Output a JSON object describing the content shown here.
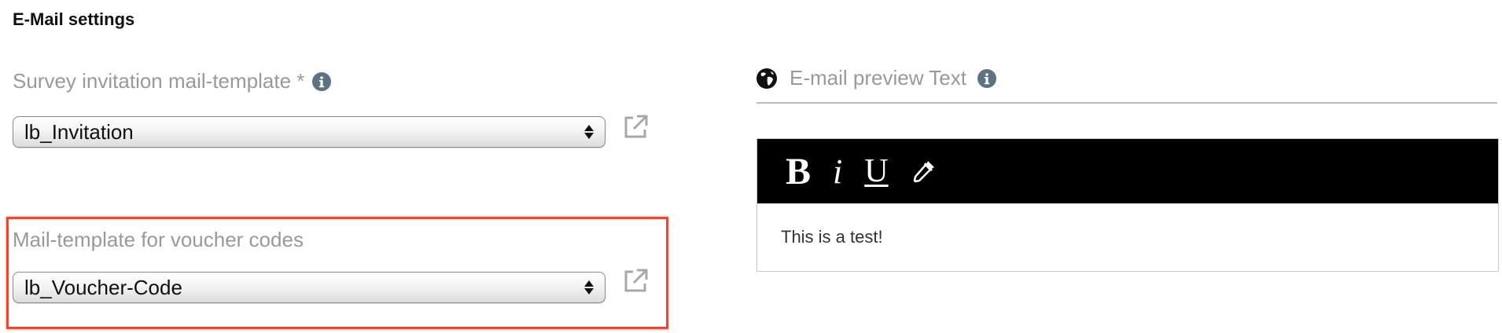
{
  "section": {
    "title": "E-Mail settings"
  },
  "invitation": {
    "label": "Survey invitation mail-template *",
    "selected": "lb_Invitation"
  },
  "voucher": {
    "label": "Mail-template for voucher codes",
    "selected": "lb_Voucher-Code"
  },
  "preview": {
    "label": "E-mail preview Text",
    "toolbar": {
      "bold": "B",
      "italic": "i",
      "underline": "U"
    },
    "body_text": "This is a test!"
  },
  "colors": {
    "highlight": "#e14b3a",
    "info_icon": "#5d7282",
    "toolbar_bg": "#000000",
    "label_gray": "#999999"
  },
  "icons": [
    "info-icon",
    "external-link-icon",
    "globe-icon",
    "color-picker-icon"
  ]
}
